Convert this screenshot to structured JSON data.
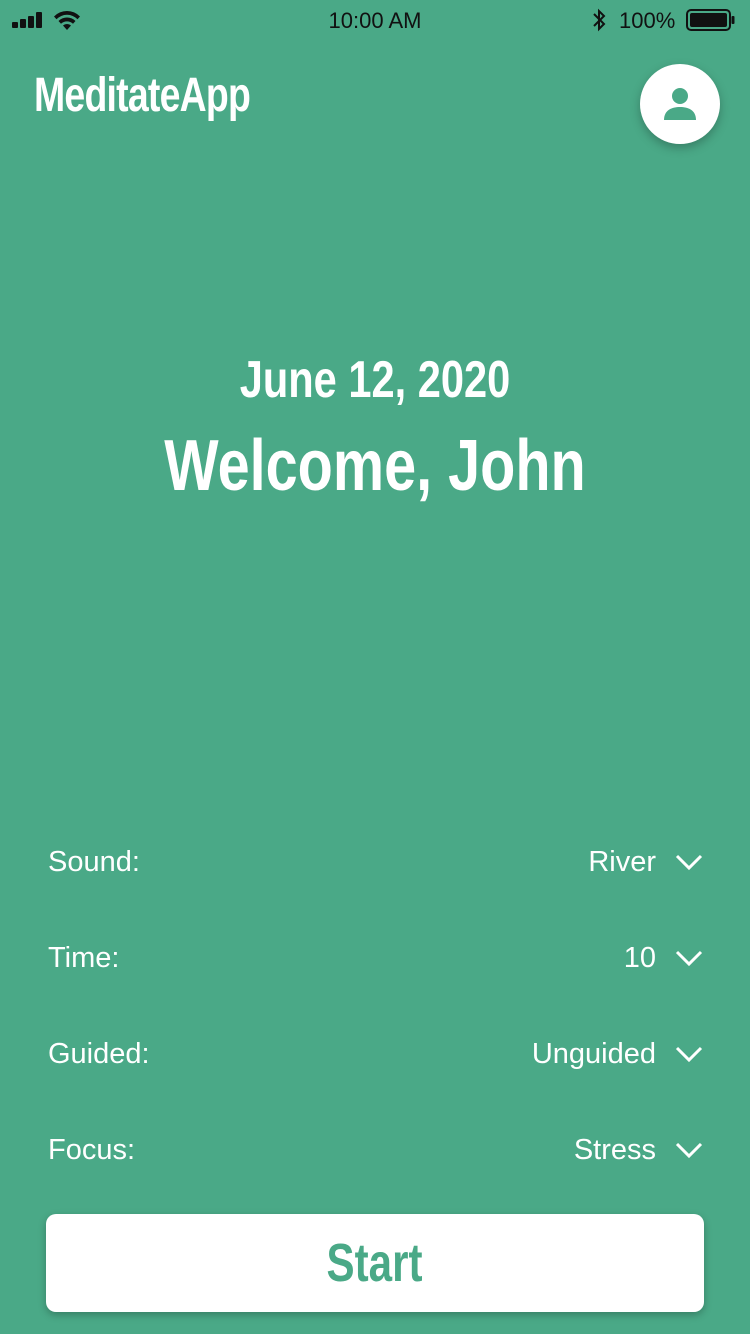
{
  "status_bar": {
    "time": "10:00 AM",
    "battery_percent": "100%",
    "icons": [
      "signal-icon",
      "wifi-icon",
      "bluetooth-icon",
      "battery-icon"
    ]
  },
  "header": {
    "app_title": "MeditateApp",
    "profile_icon": "user-icon"
  },
  "hero": {
    "date": "June 12, 2020",
    "welcome": "Welcome, John"
  },
  "settings": [
    {
      "label": "Sound:",
      "value": "River"
    },
    {
      "label": "Time:",
      "value": "10"
    },
    {
      "label": "Guided:",
      "value": "Unguided"
    },
    {
      "label": "Focus:",
      "value": "Stress"
    }
  ],
  "start_button": {
    "label": "Start"
  },
  "colors": {
    "background": "#4aa987",
    "accent_text": "#4aa987",
    "surface": "#ffffff"
  }
}
